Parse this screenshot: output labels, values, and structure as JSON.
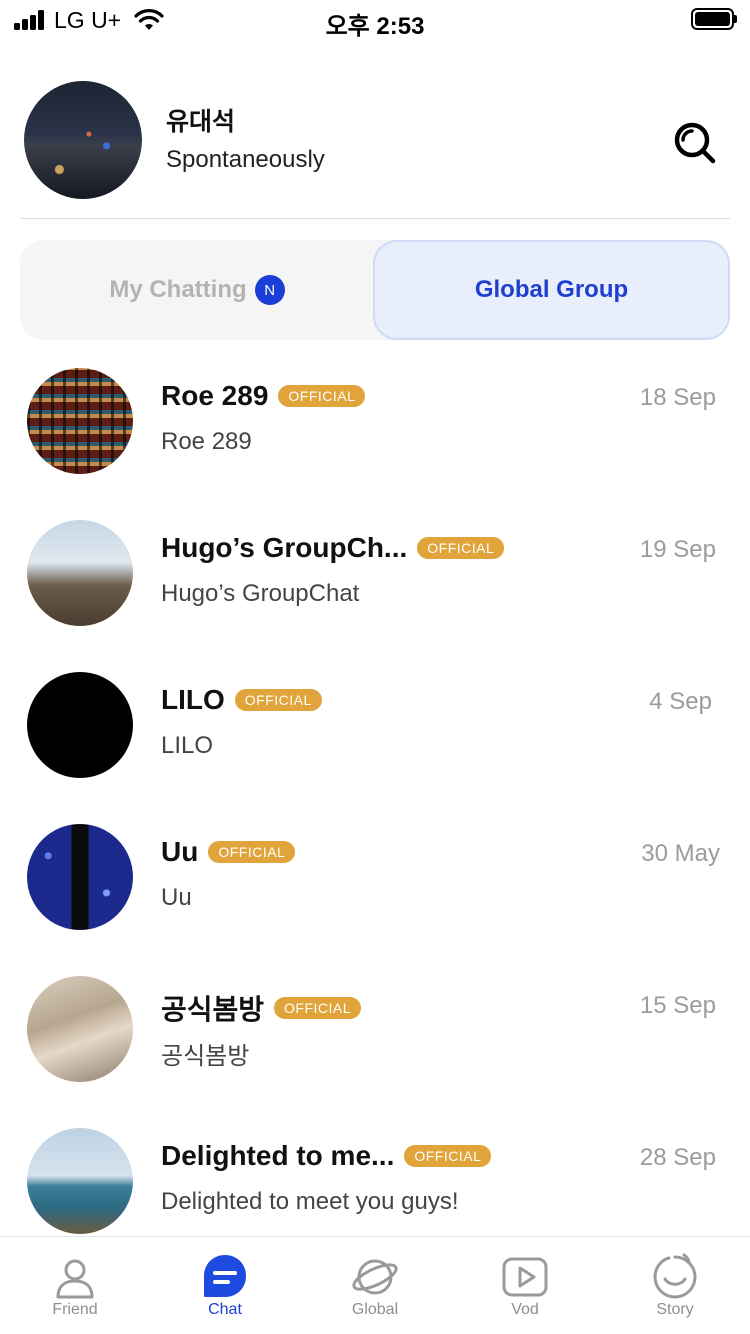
{
  "status_bar": {
    "carrier": "LG U+",
    "time": "오후 2:53"
  },
  "profile": {
    "name": "유대석",
    "status": "Spontaneously"
  },
  "tabs": {
    "my_chatting": "My Chatting",
    "my_chatting_badge": "N",
    "global_group": "Global Group",
    "active": "global_group"
  },
  "official_label": "OFFICIAL",
  "chats": [
    {
      "name": "Roe 289",
      "date": "18 Sep",
      "preview": "Roe 289",
      "official": "OFFICIAL"
    },
    {
      "name": "Hugo’s GroupCh...",
      "date": "19 Sep",
      "preview": "Hugo’s GroupChat",
      "official": "OFFICIAL"
    },
    {
      "name": "LILO",
      "date": "4 Sep",
      "preview": "LILO",
      "official": "OFFICIAL"
    },
    {
      "name": "Uu",
      "date": "30 May",
      "preview": "Uu",
      "official": "OFFICIAL"
    },
    {
      "name": "공식봄방",
      "date": "15 Sep",
      "preview": "공식봄방",
      "official": "OFFICIAL"
    },
    {
      "name": "Delighted to me...",
      "date": "28 Sep",
      "preview": "Delighted to meet you guys!",
      "official": "OFFICIAL"
    }
  ],
  "bottom_nav": [
    {
      "label": "Friend",
      "icon": "person-icon"
    },
    {
      "label": "Chat",
      "icon": "chat-bubble-icon",
      "active": true
    },
    {
      "label": "Global",
      "icon": "planet-icon"
    },
    {
      "label": "Vod",
      "icon": "play-video-icon"
    },
    {
      "label": "Story",
      "icon": "story-face-icon"
    }
  ],
  "colors": {
    "accent": "#1f3fcf",
    "official_badge": "#e0a43a",
    "active_tab_bg": "#e8eefc",
    "inactive_text": "#b3b3b3",
    "date_text": "#9b9b9b"
  }
}
